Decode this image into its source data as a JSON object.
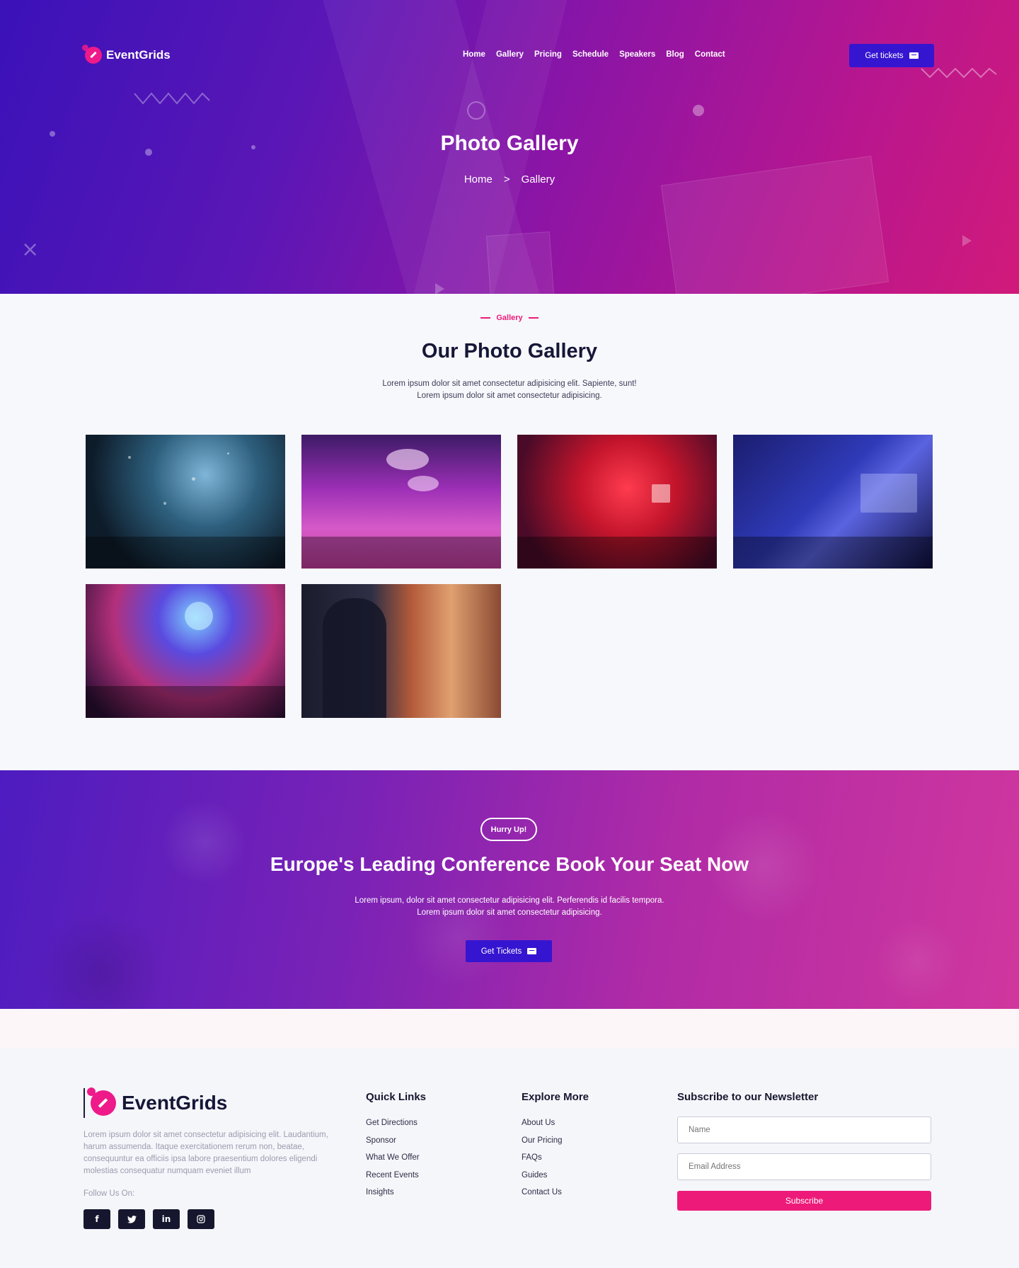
{
  "brand": {
    "name": "EventGrids"
  },
  "nav": {
    "items": [
      "Home",
      "Gallery",
      "Pricing",
      "Schedule",
      "Speakers",
      "Blog",
      "Contact"
    ],
    "cta_label": "Get tickets"
  },
  "hero": {
    "title": "Photo Gallery",
    "breadcrumb": {
      "home": "Home",
      "separator": ">",
      "current": "Gallery"
    }
  },
  "gallery": {
    "tag": "Gallery",
    "title": "Our Photo Gallery",
    "description_line1": "Lorem ipsum dolor sit amet consectetur adipisicing elit. Sapiente, sunt!",
    "description_line2": "Lorem ipsum dolor sit amet consectetur adipisicing.",
    "photos": [
      "confetti-concert",
      "purple-conference-hall",
      "red-stage-event",
      "blue-stage-keynote",
      "party-crowd-lights",
      "speaker-audience"
    ]
  },
  "cta": {
    "badge": "Hurry Up!",
    "title": "Europe's Leading Conference Book Your Seat Now",
    "description_line1": "Lorem ipsum, dolor sit amet consectetur adipisicing elit. Perferendis id facilis tempora.",
    "description_line2": "Lorem ipsum dolor sit amet consectetur adipisicing.",
    "button_label": "Get Tickets"
  },
  "footer": {
    "about": "Lorem ipsum dolor sit amet consectetur adipisicing elit. Laudantium, harum assumenda. Itaque exercitationem rerum non, beatae, consequuntur ea officiis ipsa labore praesentium dolores eligendi molestias consequatur numquam eveniet illum",
    "follow_label": "Follow Us On:",
    "socials": [
      "f",
      "twitter",
      "in",
      "instagram"
    ],
    "quick_links": {
      "title": "Quick Links",
      "items": [
        "Get Directions",
        "Sponsor",
        "What We Offer",
        "Recent Events",
        "Insights"
      ]
    },
    "explore": {
      "title": "Explore More",
      "items": [
        "About Us",
        "Our Pricing",
        "FAQs",
        "Guides",
        "Contact Us"
      ]
    },
    "newsletter": {
      "title": "Subscribe to our Newsletter",
      "name_placeholder": "Name",
      "email_placeholder": "Email Address",
      "button_label": "Subscribe"
    }
  },
  "colors": {
    "accent_pink": "#ee1a7a",
    "button_blue": "#3515d0",
    "dark_text": "#161737"
  }
}
